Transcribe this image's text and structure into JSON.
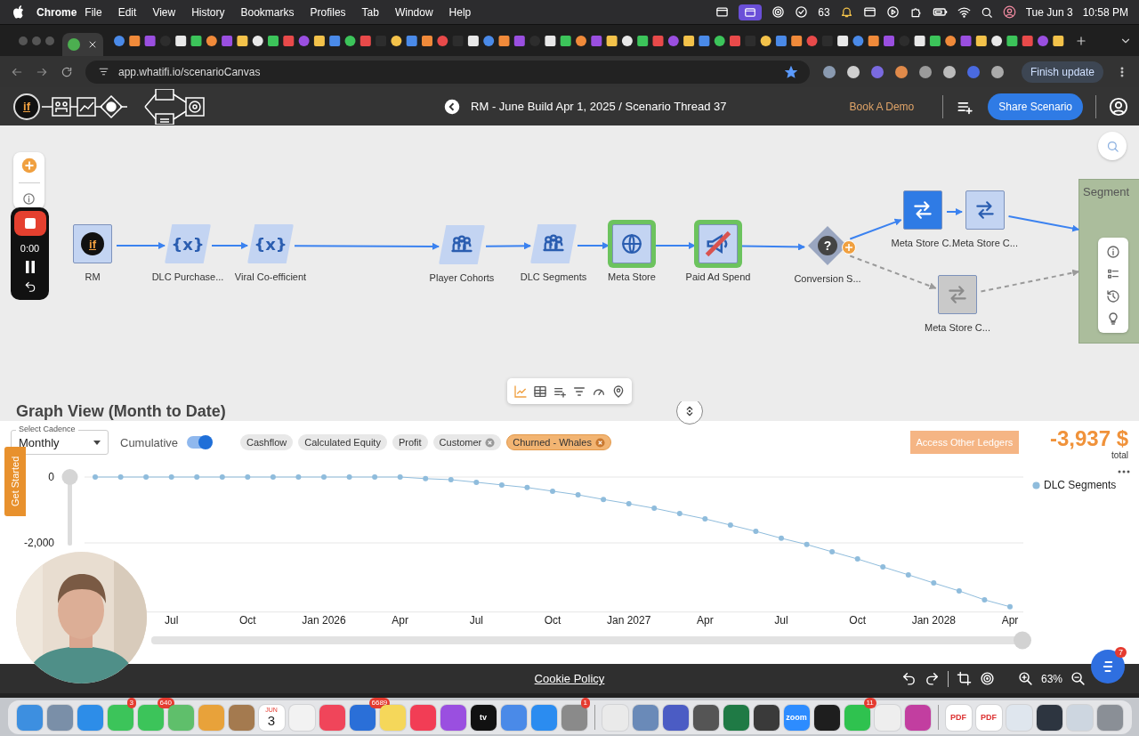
{
  "menu_bar": {
    "app": "Chrome",
    "menus": [
      "File",
      "Edit",
      "View",
      "History",
      "Bookmarks",
      "Profiles",
      "Tab",
      "Window",
      "Help"
    ],
    "status_count": "63",
    "date": "Tue Jun 3",
    "time": "10:58 PM"
  },
  "browser": {
    "url": "app.whatifi.io/scenarioCanvas",
    "bookmarked": true,
    "update_button": "Finish update"
  },
  "header": {
    "logo": "if",
    "title": "RM - June Build Apr 1, 2025 / Scenario Thread 37",
    "demo_link": "Book A Demo",
    "share_button": "Share Scenario"
  },
  "recorder": {
    "time": "0:00"
  },
  "nodes": [
    {
      "kind": "rm",
      "label": "RM",
      "icon_text": "if",
      "highlighted": false,
      "selected": false,
      "disabled": false
    },
    {
      "kind": "formula",
      "label": "DLC Purchase...",
      "icon_text": "{x}",
      "highlighted": false,
      "selected": false,
      "disabled": false
    },
    {
      "kind": "formula",
      "label": "Viral Co-efficient",
      "icon_text": "{x}",
      "highlighted": false,
      "selected": false,
      "disabled": false
    },
    {
      "kind": "group",
      "label": "Player Cohorts",
      "highlighted": false,
      "selected": false,
      "disabled": false
    },
    {
      "kind": "group",
      "label": "DLC Segments",
      "highlighted": false,
      "selected": false,
      "disabled": false
    },
    {
      "kind": "store",
      "label": "Meta Store",
      "highlighted": true,
      "selected": false,
      "disabled": false
    },
    {
      "kind": "ad",
      "label": "Paid Ad Spend",
      "highlighted": true,
      "selected": false,
      "disabled": false
    },
    {
      "kind": "decision",
      "label": "Conversion S...",
      "icon_text": "?",
      "highlighted": false,
      "selected": false,
      "disabled": false
    },
    {
      "kind": "exchange",
      "label": "Meta Store C..",
      "highlighted": false,
      "selected": true,
      "disabled": false
    },
    {
      "kind": "exchange",
      "label": "Meta Store C...",
      "highlighted": false,
      "selected": false,
      "disabled": false
    },
    {
      "kind": "exchange",
      "label": "Meta Store C...",
      "highlighted": false,
      "selected": false,
      "disabled": true
    }
  ],
  "segment_panel": {
    "title": "Segment"
  },
  "view_tools": [
    {
      "kind": "line",
      "selected": true
    },
    {
      "kind": "table",
      "selected": false
    },
    {
      "kind": "add-list",
      "selected": false
    },
    {
      "kind": "filter",
      "selected": false
    },
    {
      "kind": "gauge",
      "selected": false
    },
    {
      "kind": "pin",
      "selected": false
    }
  ],
  "graph": {
    "title": "Graph View (Month to Date)",
    "cadence_label": "Select Cadence",
    "cadence": "Monthly",
    "cumulative_label": "Cumulative",
    "cumulative": true,
    "filters": [
      {
        "label": "Cashflow",
        "removable": false,
        "selected": false
      },
      {
        "label": "Calculated Equity",
        "removable": false,
        "selected": false
      },
      {
        "label": "Profit",
        "removable": false,
        "selected": false
      },
      {
        "label": "Customer",
        "removable": true,
        "selected": false
      },
      {
        "label": "Churned - Whales",
        "removable": true,
        "selected": true
      }
    ],
    "ledgers_button": "Access Other Ledgers",
    "total": "-3,937 $",
    "total_label": "total",
    "chart_data": {
      "type": "line",
      "categories": [
        null,
        null,
        null,
        "Jul",
        null,
        null,
        "Oct",
        null,
        null,
        "Jan 2026",
        null,
        null,
        "Apr",
        null,
        null,
        "Jul",
        null,
        null,
        "Oct",
        null,
        null,
        "Jan 2027",
        null,
        null,
        "Apr",
        null,
        null,
        "Jul",
        null,
        null,
        "Oct",
        null,
        null,
        "Jan 2028",
        null,
        null,
        "Apr"
      ],
      "series": [
        {
          "name": "DLC Segments",
          "color": "#8fbcdc",
          "marker": true,
          "values": [
            0,
            0,
            0,
            0,
            0,
            0,
            0,
            0,
            0,
            0,
            0,
            0,
            0,
            -50,
            -80,
            -160,
            -240,
            -320,
            -430,
            -540,
            -680,
            -810,
            -950,
            -1110,
            -1270,
            -1460,
            -1650,
            -1860,
            -2050,
            -2270,
            -2490,
            -2730,
            -2970,
            -3220,
            -3460,
            -3730,
            -3940
          ]
        }
      ],
      "ylim": [
        -4100,
        0
      ],
      "yticks": [
        {
          "value": 0,
          "label": "0"
        },
        {
          "value": -2000,
          "label": "-2,000"
        }
      ]
    }
  },
  "get_started": "Get Started",
  "footer": {
    "link": "Cookie Policy",
    "zoom": "63%"
  },
  "chat": {
    "badge": "7"
  },
  "dock": [
    {
      "kind": "app",
      "color": "#3d8fe0"
    },
    {
      "kind": "app",
      "color": "#7a8fa8"
    },
    {
      "kind": "app",
      "color": "#2d8de8"
    },
    {
      "kind": "app",
      "color": "#3cc45a",
      "badge": "3"
    },
    {
      "kind": "app",
      "color": "#3cc45a",
      "badge": "640"
    },
    {
      "kind": "app",
      "color": "#5fbf6b"
    },
    {
      "kind": "app",
      "color": "#e8a23a"
    },
    {
      "kind": "app",
      "color": "#a47a4f"
    },
    {
      "kind": "calendar",
      "color": "#ffffff",
      "month": "JUN",
      "day": "3"
    },
    {
      "kind": "app",
      "color": "#f2f2f2"
    },
    {
      "kind": "app",
      "color": "#f0455a"
    },
    {
      "kind": "app",
      "color": "#2a6fd8",
      "badge": "6689"
    },
    {
      "kind": "app",
      "color": "#f5d75a"
    },
    {
      "kind": "app",
      "color": "#f23d55"
    },
    {
      "kind": "app",
      "color": "#9a4fe0"
    },
    {
      "kind": "app",
      "color": "#111111",
      "text": "tv"
    },
    {
      "kind": "app",
      "color": "#4a8ae8"
    },
    {
      "kind": "app",
      "color": "#2b8cf0"
    },
    {
      "kind": "app",
      "color": "#8a8a8a",
      "badge": "1"
    },
    {
      "kind": "separator"
    },
    {
      "kind": "app",
      "color": "#eaeaea"
    },
    {
      "kind": "app",
      "color": "#6a8ab8"
    },
    {
      "kind": "app",
      "color": "#4b5cc4"
    },
    {
      "kind": "app",
      "color": "#555555"
    },
    {
      "kind": "app",
      "color": "#1f7a45"
    },
    {
      "kind": "app",
      "color": "#3a3a3a"
    },
    {
      "kind": "app",
      "color": "#2d8cff",
      "text": "zoom"
    },
    {
      "kind": "app",
      "color": "#1e1e1e"
    },
    {
      "kind": "app",
      "color": "#2fc24f",
      "badge": "11"
    },
    {
      "kind": "app",
      "color": "#eeeeee"
    },
    {
      "kind": "app",
      "color": "#c23ea0"
    },
    {
      "kind": "separator"
    },
    {
      "kind": "app",
      "color": "#ffffff",
      "text": "PDF"
    },
    {
      "kind": "app",
      "color": "#ffffff",
      "text": "PDF"
    },
    {
      "kind": "app",
      "color": "#dfe6ee"
    },
    {
      "kind": "app",
      "color": "#2d3540"
    },
    {
      "kind": "app",
      "color": "#cdd6e0"
    },
    {
      "kind": "app",
      "color": "#8a8f96"
    }
  ]
}
